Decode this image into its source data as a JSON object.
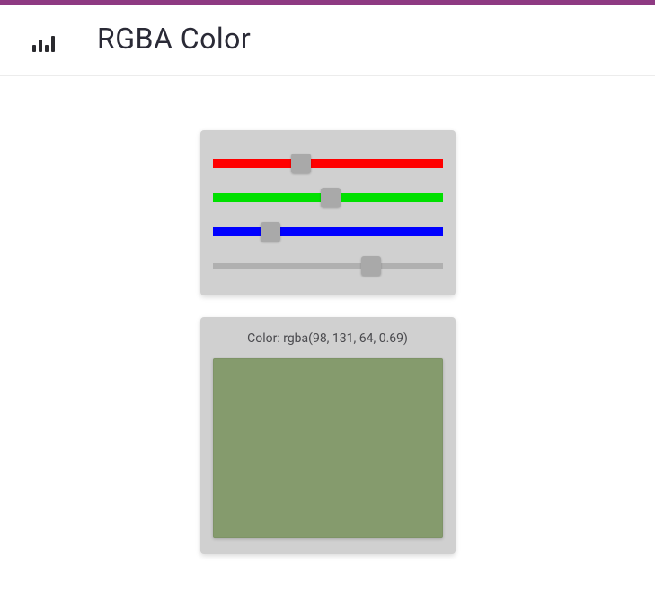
{
  "header": {
    "title": "RGBA Color"
  },
  "sliders": {
    "red": {
      "value": 98,
      "max": 255
    },
    "green": {
      "value": 131,
      "max": 255
    },
    "blue": {
      "value": 64,
      "max": 255
    },
    "alpha": {
      "value": 0.69,
      "max": 1.0
    }
  },
  "preview": {
    "label": "Color: rgba(98, 131, 64, 0.69)",
    "rgba": "rgba(98, 131, 64, 0.69)"
  }
}
